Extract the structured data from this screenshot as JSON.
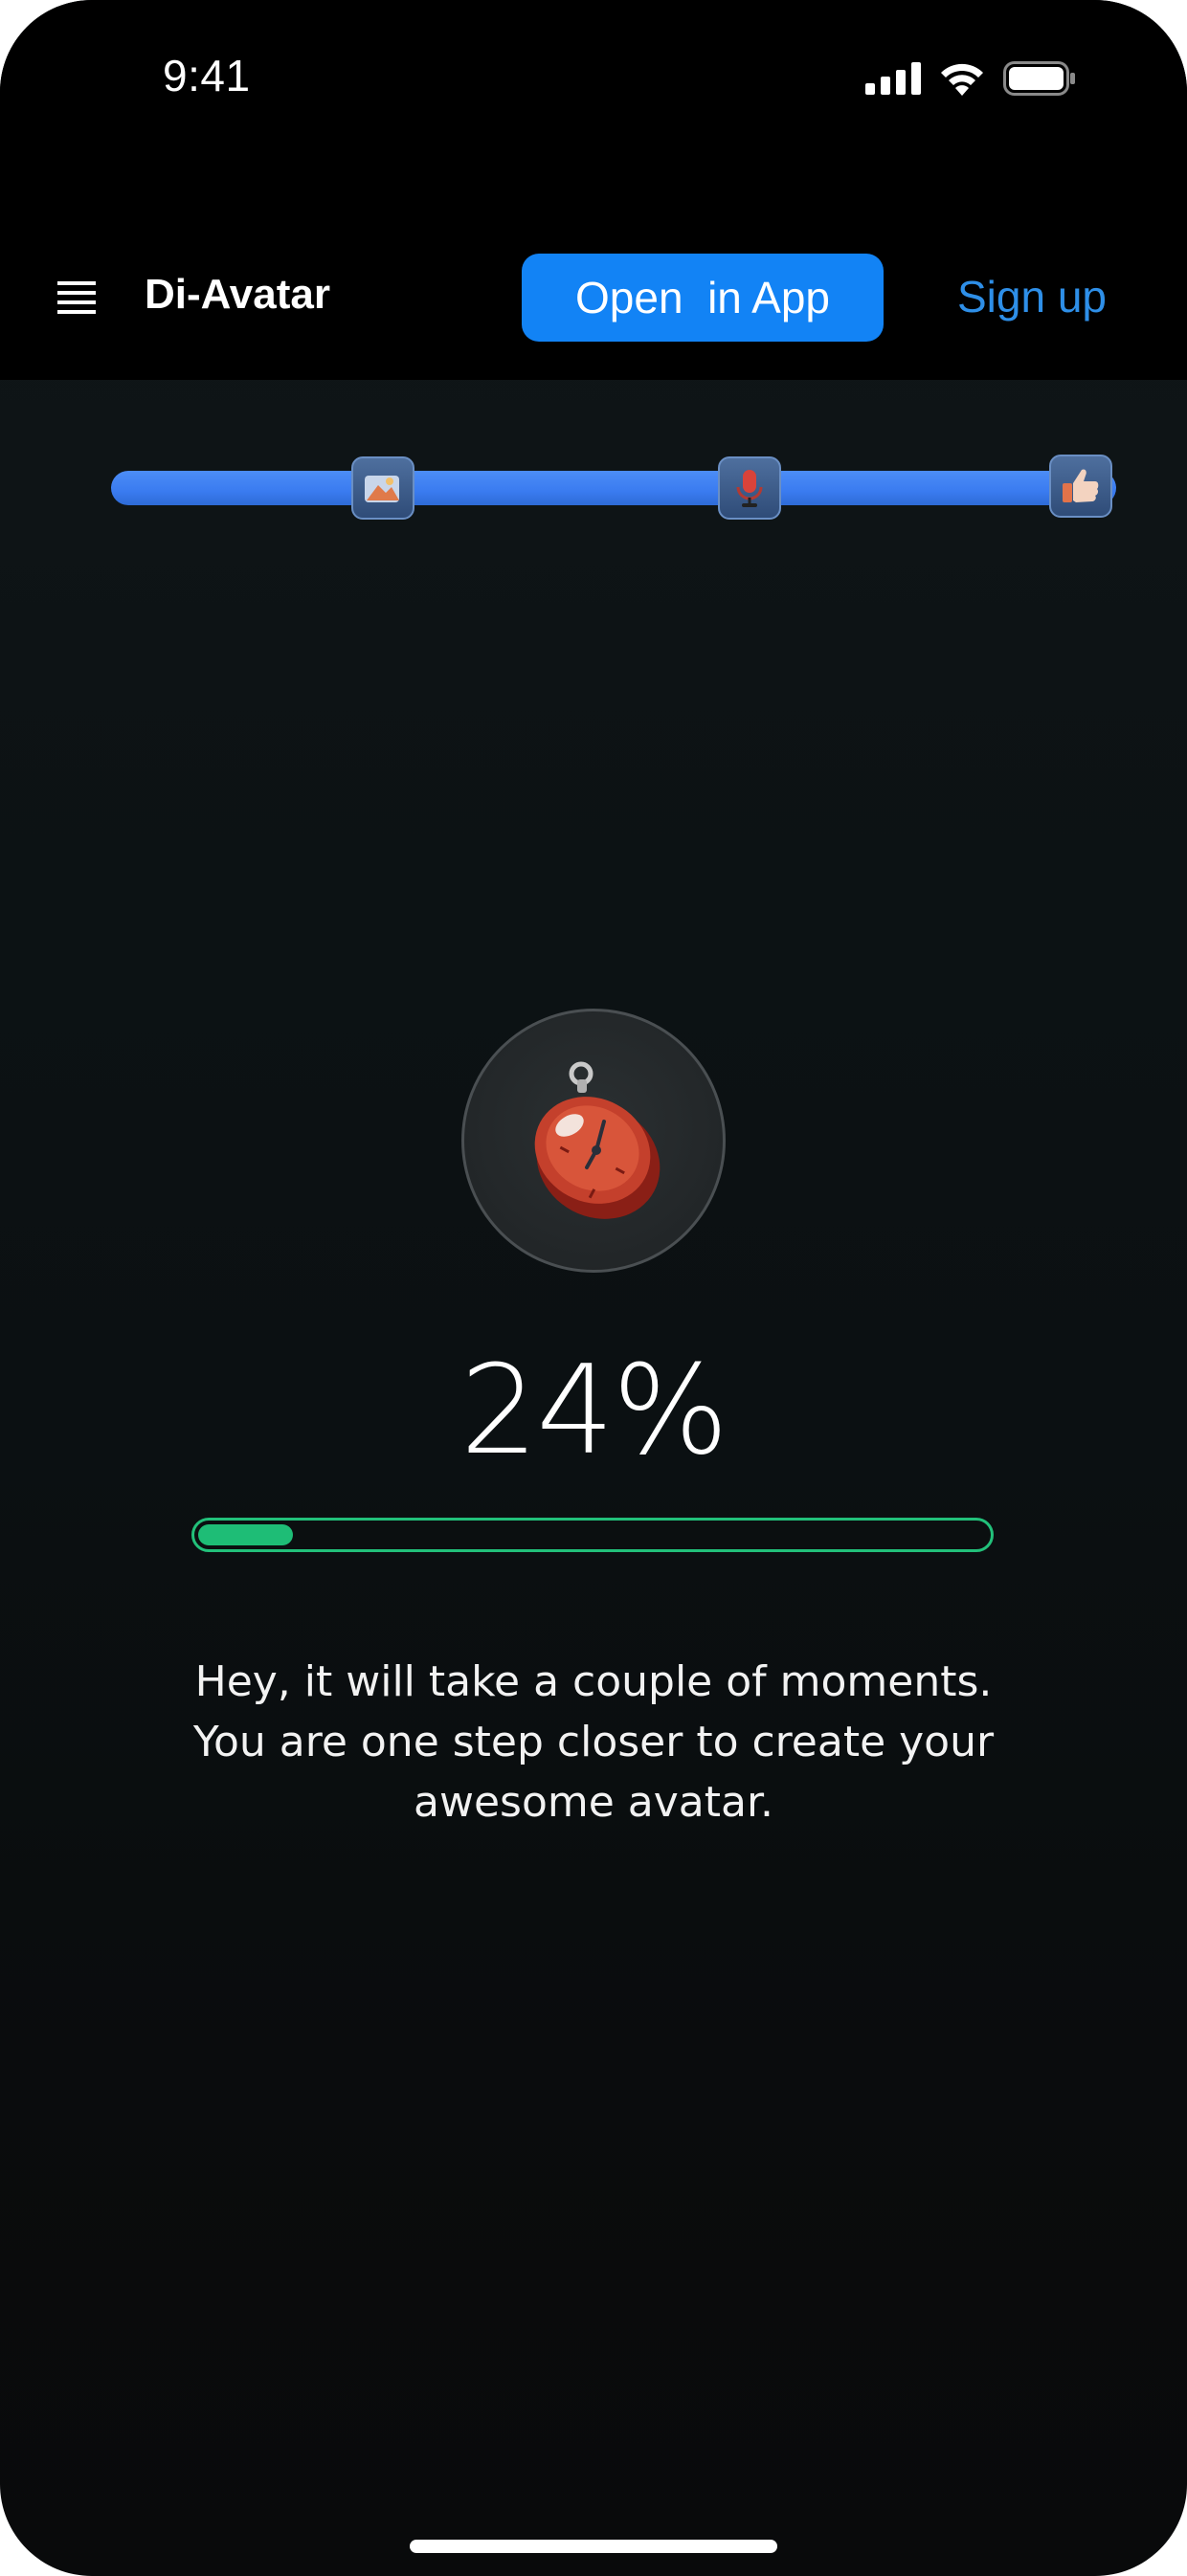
{
  "status_bar": {
    "time": "9:41",
    "icons": [
      "cellular-signal-icon",
      "wifi-icon",
      "battery-icon"
    ]
  },
  "header": {
    "menu_icon": "hamburger-menu-icon",
    "title": "Di-Avatar",
    "open_app_label": "Open  in App",
    "signup_label": "Sign up"
  },
  "steps": {
    "items": [
      {
        "icon": "image-icon"
      },
      {
        "icon": "microphone-icon"
      },
      {
        "icon": "thumbs-up-icon"
      }
    ],
    "track_color": "#3a7bf0"
  },
  "loading": {
    "icon": "stopwatch-icon",
    "percent_label": "24%",
    "progress": 0.12,
    "progress_color": "#1ebd76",
    "message_lines": [
      "Hey, it will take a couple of moments.",
      "You are one step closer to create your",
      "awesome avatar."
    ]
  },
  "colors": {
    "accent": "#1283f5",
    "link": "#2e8fe8",
    "background": "#0b1012"
  }
}
